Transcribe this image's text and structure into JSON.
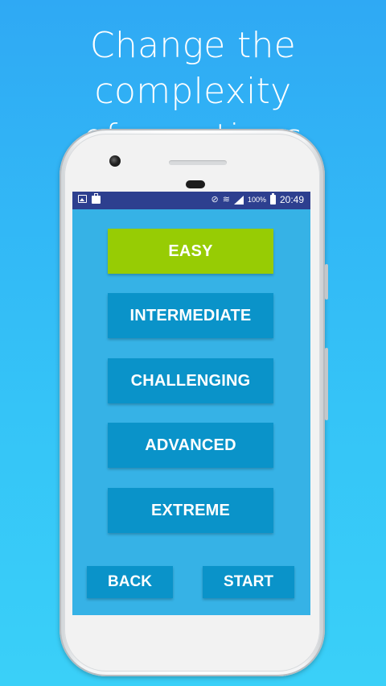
{
  "headline": {
    "line1": "Change the complexity",
    "line2": "of questions"
  },
  "status_bar": {
    "icons_left": [
      "image-icon",
      "briefcase-icon"
    ],
    "icons_right": [
      "mute-icon",
      "wifi-icon",
      "signal-icon",
      "battery-icon"
    ],
    "battery_percent": "100%",
    "time": "20:49",
    "color": "#2d3f8f"
  },
  "levels": [
    {
      "label": "EASY",
      "selected": true
    },
    {
      "label": "INTERMEDIATE",
      "selected": false
    },
    {
      "label": "CHALLENGING",
      "selected": false
    },
    {
      "label": "ADVANCED",
      "selected": false
    },
    {
      "label": "EXTREME",
      "selected": false
    }
  ],
  "actions": {
    "back_label": "BACK",
    "start_label": "START"
  },
  "colors": {
    "background_top": "#2fa9f4",
    "screen": "#36b2e6",
    "button": "#0a93c9",
    "selected_button": "#97cc04"
  }
}
